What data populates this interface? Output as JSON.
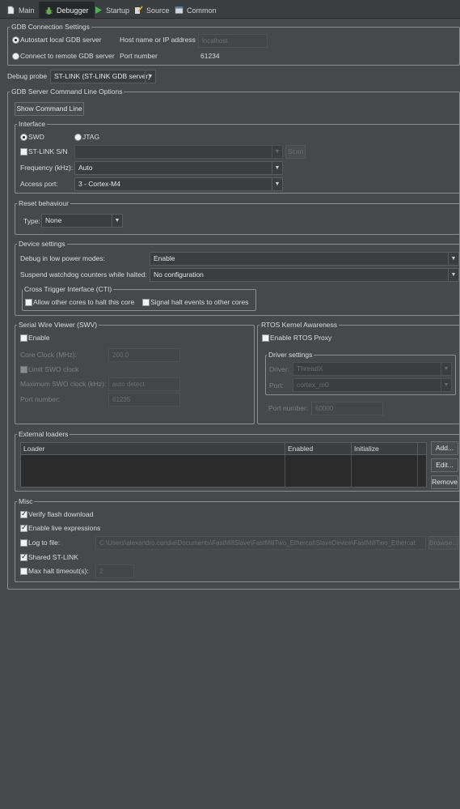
{
  "tabs": [
    {
      "label": "Main",
      "icon": "document-icon"
    },
    {
      "label": "Debugger",
      "icon": "bug-icon"
    },
    {
      "label": "Startup",
      "icon": "play-icon"
    },
    {
      "label": "Source",
      "icon": "source-icon"
    },
    {
      "label": "Common",
      "icon": "common-icon"
    }
  ],
  "active_tab": "Debugger",
  "gdb_connection": {
    "title": "GDB Connection Settings",
    "autostart_label": "Autostart local GDB server",
    "remote_label": "Connect to remote GDB server",
    "host_label": "Host name or IP address",
    "host_value": "localhost",
    "port_label": "Port number",
    "port_value": "61234"
  },
  "debug_probe": {
    "label": "Debug probe",
    "value": "ST-LINK (ST-LINK GDB server)"
  },
  "server_options": {
    "title": "GDB Server Command Line Options",
    "show_cmd_button": "Show Command Line"
  },
  "interface": {
    "title": "Interface",
    "swd_label": "SWD",
    "jtag_label": "JTAG",
    "stlink_sn_label": "ST-LINK S/N",
    "stlink_sn_value": "",
    "scan_button": "Scan",
    "frequency_label": "Frequency (kHz):",
    "frequency_value": "Auto",
    "access_port_label": "Access port:",
    "access_port_value": "3 - Cortex-M4"
  },
  "reset": {
    "title": "Reset behaviour",
    "type_label": "Type:",
    "type_value": "None"
  },
  "device": {
    "title": "Device settings",
    "low_power_label": "Debug in low power modes:",
    "low_power_value": "Enable",
    "watchdog_label": "Suspend watchdog counters while halted:",
    "watchdog_value": "No configuration",
    "cti_title": "Cross Trigger Interface (CTI)",
    "cti_allow_label": "Allow other cores to halt this core",
    "cti_signal_label": "Signal halt events to other cores"
  },
  "swv": {
    "title": "Serial Wire Viewer (SWV)",
    "enable_label": "Enable",
    "core_clock_label": "Core Clock (MHz):",
    "core_clock_value": "200.0",
    "limit_swo_label": "Limit SWO clock",
    "max_swo_label": "Maximum SWO clock (kHz):",
    "max_swo_value": "auto detect",
    "port_label": "Port number:",
    "port_value": "61235"
  },
  "rtos": {
    "title": "RTOS Kernel Awareness",
    "enable_label": "Enable RTOS Proxy",
    "driver_settings_title": "Driver settings",
    "driver_label": "Driver:",
    "driver_value": "ThreadX",
    "port_label": "Port:",
    "port_value": "cortex_m0",
    "port_number_label": "Port number:",
    "port_number_value": "60000"
  },
  "external_loaders": {
    "title": "External loaders",
    "columns": [
      "Loader",
      "Enabled",
      "Initialize"
    ],
    "add_button": "Add...",
    "edit_button": "Edit...",
    "remove_button": "Remove"
  },
  "misc": {
    "title": "Misc",
    "verify_flash_label": "Verify flash download",
    "live_expr_label": "Enable live expressions",
    "log_file_label": "Log to file:",
    "log_file_value": "C:\\Users\\alexandro.candia\\Documents\\FastMillSlave\\FastMillTwo_Ethercat\\SlaveDevice\\FastMillTwo_Ethercat",
    "browse_button": "Browse...",
    "shared_stlink_label": "Shared ST-LINK",
    "max_halt_label": "Max halt timeout(s):",
    "max_halt_value": "2"
  }
}
